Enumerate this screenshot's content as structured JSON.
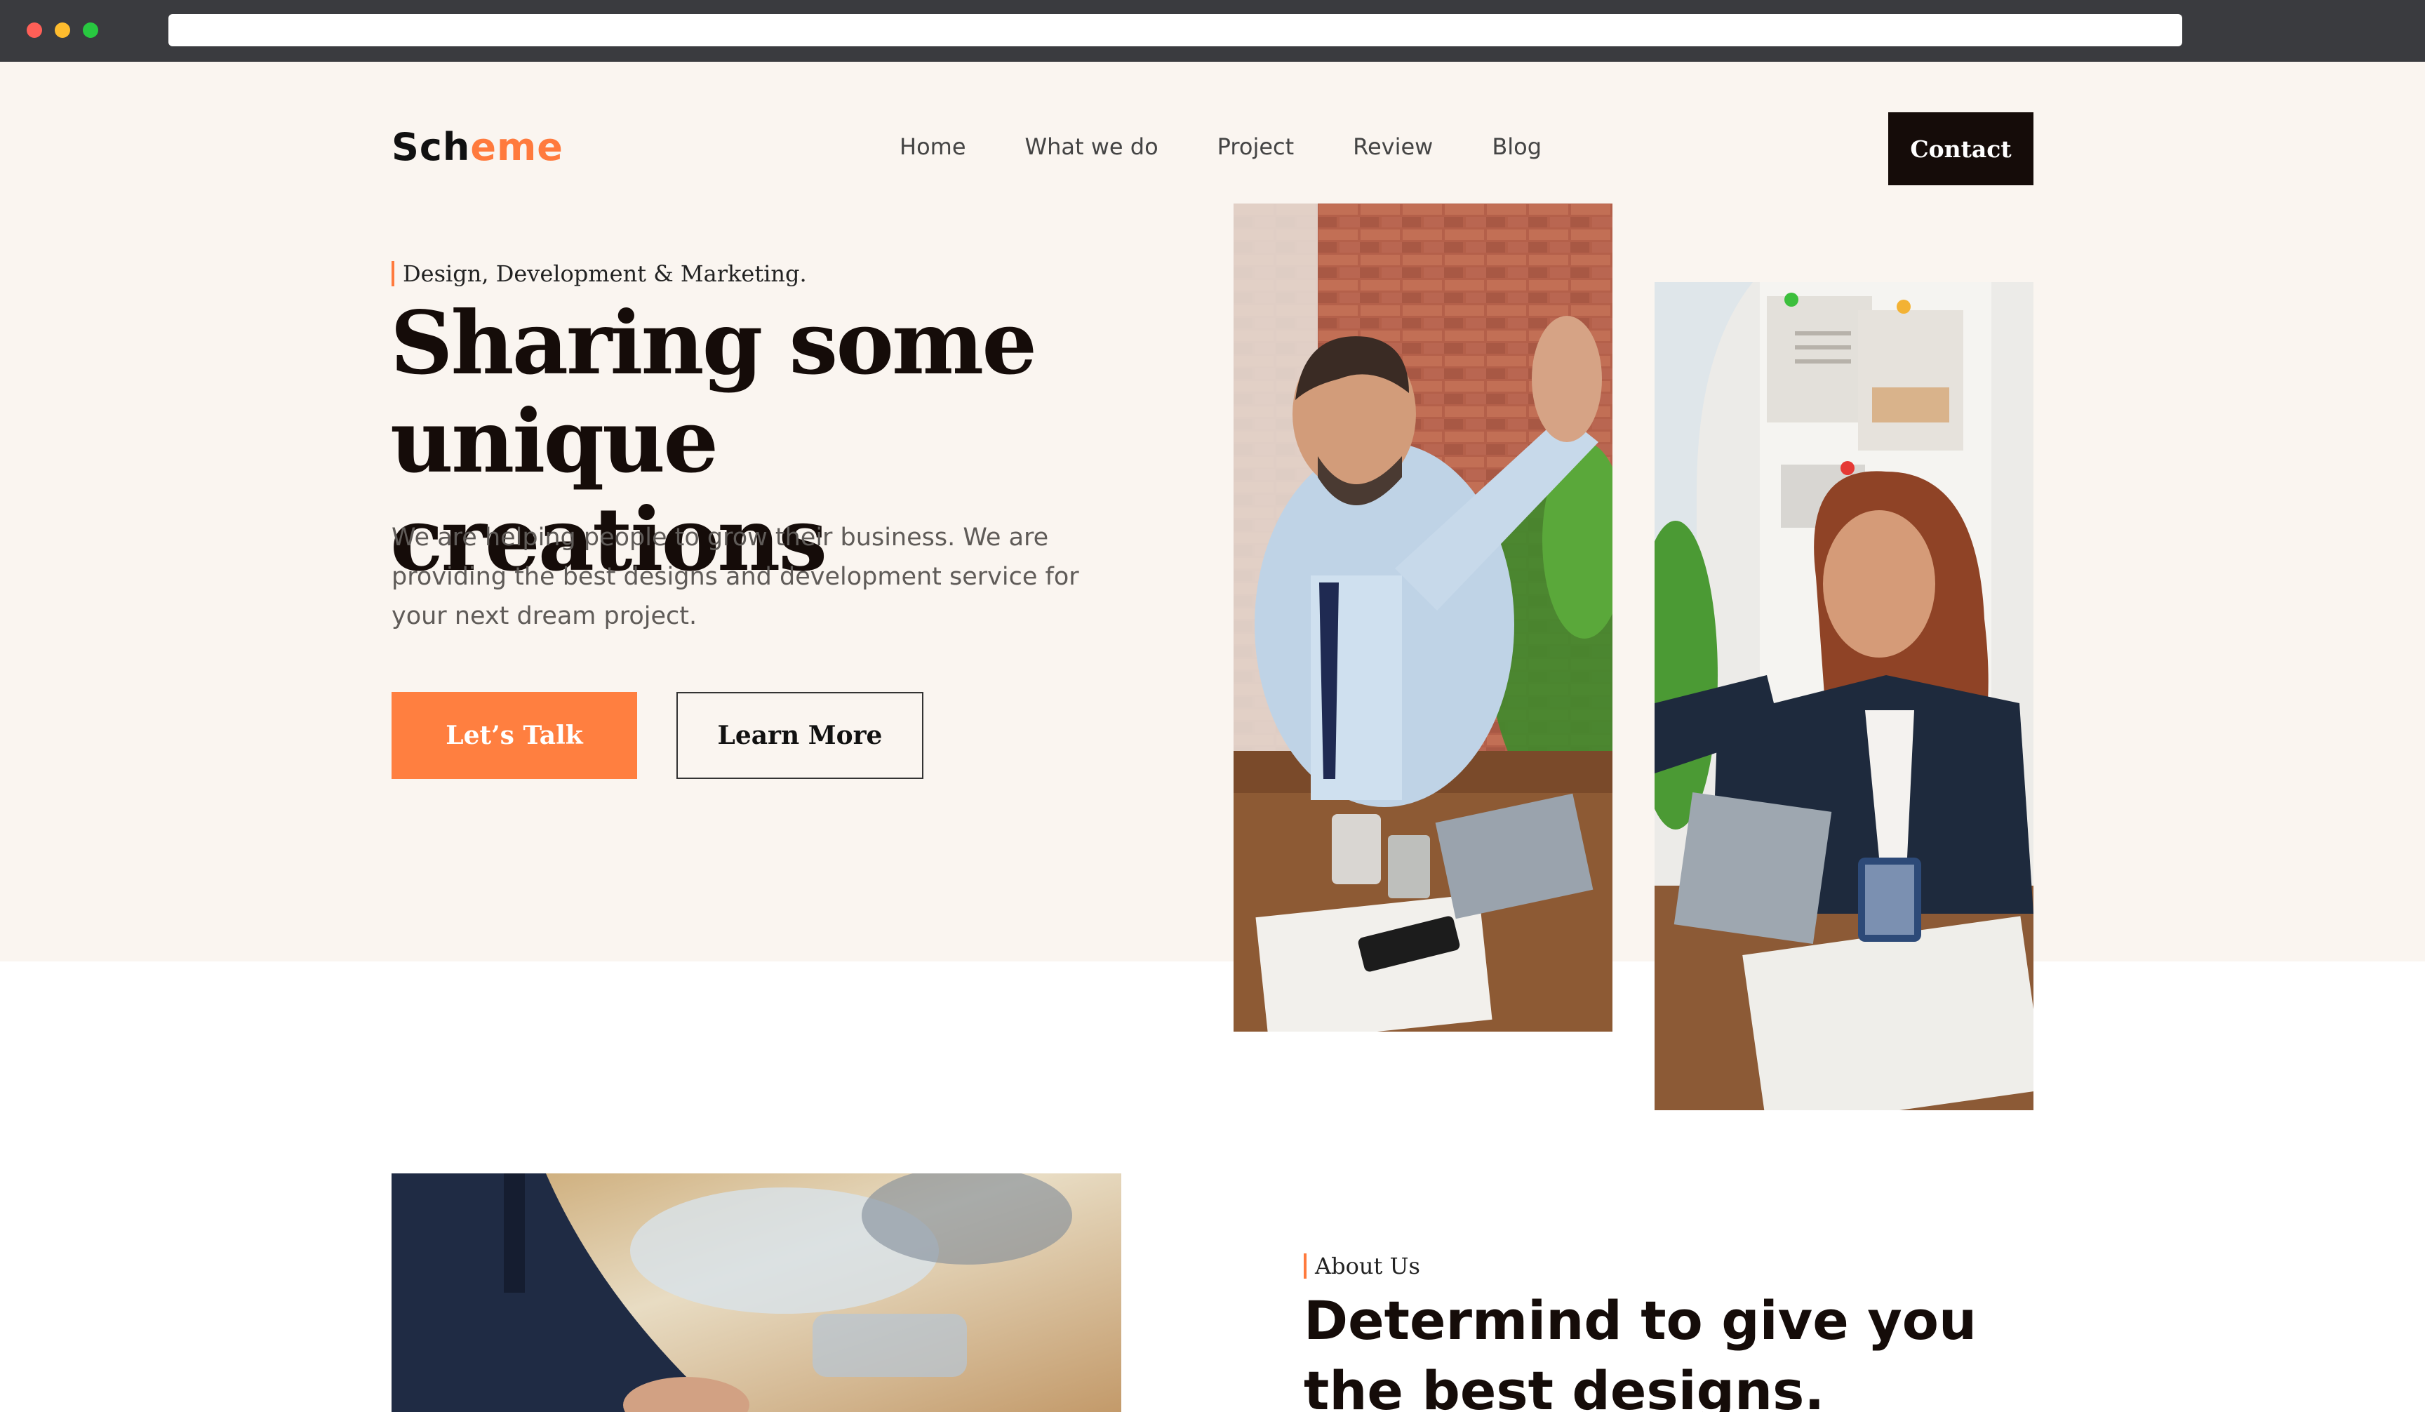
{
  "browser": {
    "url": ""
  },
  "header": {
    "logo_prefix": "Sch",
    "logo_accent": "eme",
    "nav": [
      {
        "label": "Home"
      },
      {
        "label": "What we do"
      },
      {
        "label": "Project"
      },
      {
        "label": "Review"
      },
      {
        "label": "Blog"
      }
    ],
    "contact_label": "Contact"
  },
  "hero": {
    "eyebrow": "Design, Development & Marketing.",
    "title_line1": "Sharing some",
    "title_line2": "unique creations",
    "subtitle": "We are helping people to grow their business. We are providing the best designs and development service for your next dream project.",
    "primary_button": "Let’s Talk",
    "secondary_button": "Learn More"
  },
  "about": {
    "eyebrow": "About Us",
    "title": "Determind to give you the best designs."
  },
  "colors": {
    "accent": "#ff7f40",
    "dark": "#150c09",
    "hero_background": "#faf5f0",
    "chrome": "#3a3b3f"
  }
}
